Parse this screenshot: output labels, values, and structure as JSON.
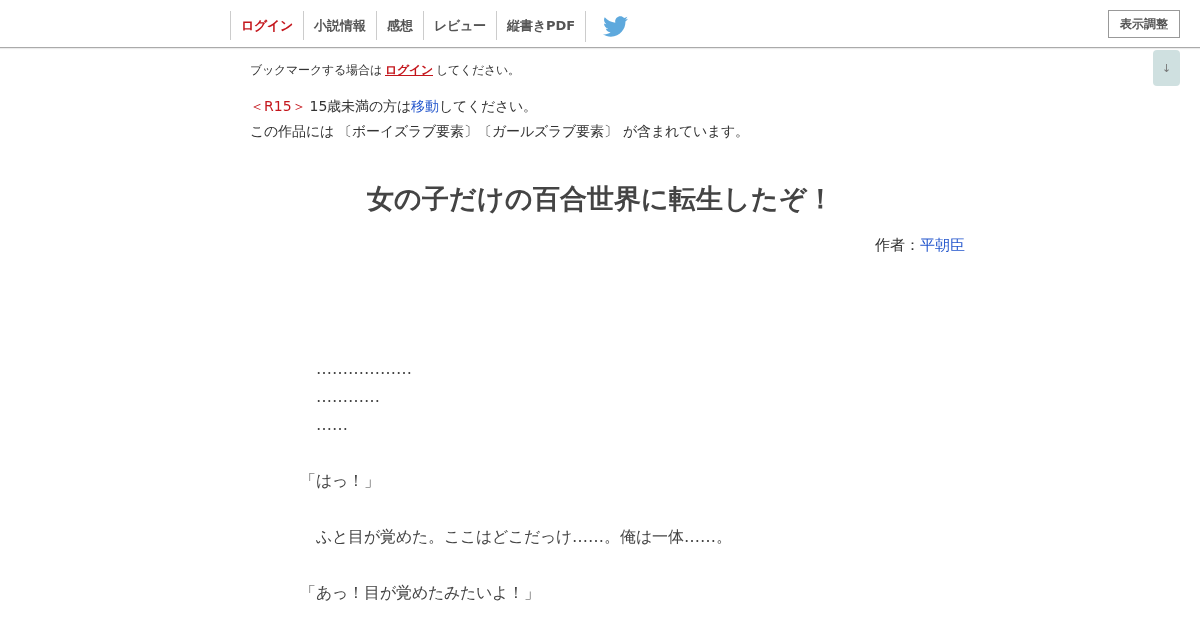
{
  "header": {
    "nav": [
      {
        "label": "ログイン",
        "kind": "login"
      },
      {
        "label": "小説情報",
        "kind": "page"
      },
      {
        "label": "感想",
        "kind": "page"
      },
      {
        "label": "レビュー",
        "kind": "page"
      },
      {
        "label": "縦書きPDF",
        "kind": "page"
      }
    ],
    "display_settings_button": "表示調整"
  },
  "scroll_down_button": "↓",
  "bookmark_notice": {
    "before": "ブックマークする場合は",
    "link": "ログイン",
    "after": "してください。"
  },
  "age_notice": {
    "rating": "＜R15＞",
    "before": "15歳未満の方は",
    "link": "移動",
    "after": "してください。"
  },
  "content_warning": "この作品には 〔ボーイズラブ要素〕〔ガールズラブ要素〕 が含まれています。",
  "title": "女の子だけの百合世界に転生したぞ！",
  "author": {
    "label": "作者：",
    "name": "平朝臣"
  },
  "body": [
    {
      "lines": [
        "　………………",
        "　…………",
        "　……"
      ]
    },
    {
      "lines": [
        "「はっ！」"
      ]
    },
    {
      "lines": [
        "　ふと目が覚めた。ここはどこだっけ……。俺は一体……。"
      ]
    },
    {
      "lines": [
        "「あっ！目が覚めたみたいよ！」"
      ]
    }
  ]
}
